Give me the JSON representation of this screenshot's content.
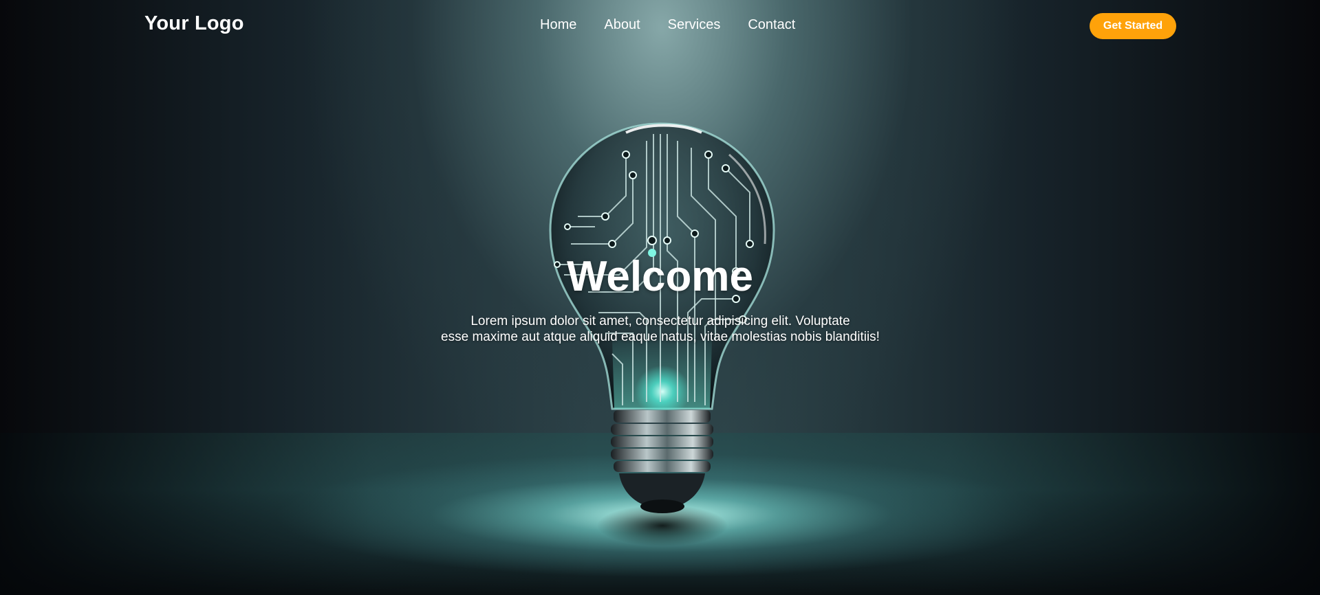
{
  "header": {
    "logo_text": "Your Logo",
    "nav": [
      {
        "label": "Home"
      },
      {
        "label": "About"
      },
      {
        "label": "Services"
      },
      {
        "label": "Contact"
      }
    ],
    "cta_label": "Get Started"
  },
  "hero": {
    "title": "Welcome",
    "description_line1": "Lorem ipsum dolor sit amet, consectetur adipisicing elit. Voluptate",
    "description_line2": "esse maxime aut atque aliquid eaque natus, vitae molestias nobis blanditiis!",
    "image": "lightbulb-circuit-illustration"
  },
  "colors": {
    "accent": "#ffa20a",
    "text": "#ffffff",
    "glow": "#4fe3cf"
  }
}
